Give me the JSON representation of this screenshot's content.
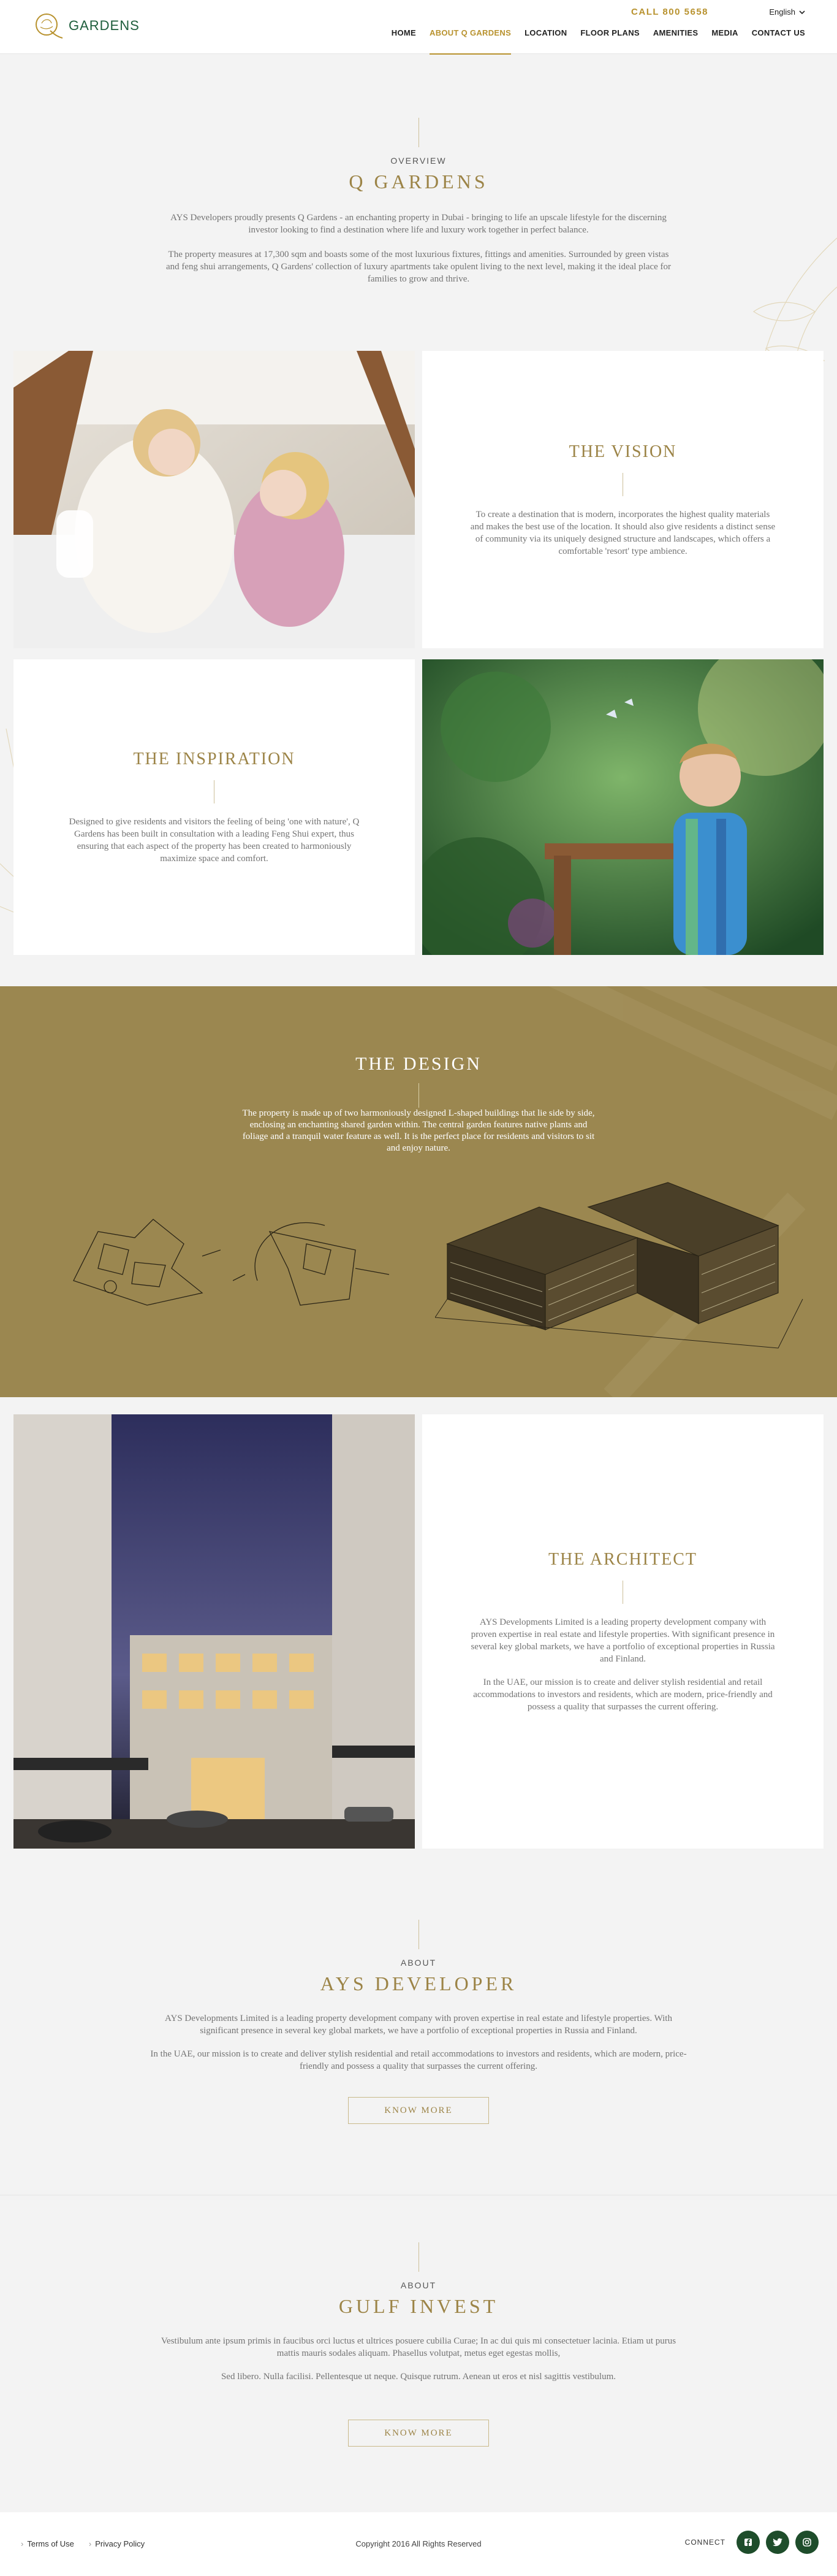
{
  "header": {
    "logo_text": "GARDENS",
    "call": "CALL 800 5658",
    "language": "English",
    "nav": [
      "HOME",
      "ABOUT Q GARDENS",
      "LOCATION",
      "FLOOR PLANS",
      "AMENITIES",
      "MEDIA",
      "CONTACT US"
    ],
    "active_nav": "ABOUT Q GARDENS"
  },
  "overview": {
    "eyebrow": "OVERVIEW",
    "title": "Q GARDENS",
    "p1": "AYS Developers proudly presents Q Gardens - an enchanting property in Dubai - bringing to life an upscale lifestyle for the discerning investor looking to find a destination where life and luxury work together in perfect balance.",
    "p2": "The property measures at 17,300 sqm and boasts some of the most luxurious fixtures, fittings and amenities. Surrounded by green vistas and feng shui arrangements, Q Gardens' collection of luxury apartments take opulent living to the next level, making it the ideal place for families to grow and thrive."
  },
  "vision": {
    "title": "THE VISION",
    "text": "To create a destination that is modern, incorporates the highest quality materials and makes the best use of the location. It should also give residents a distinct sense of community via its uniquely designed structure and landscapes, which offers a comfortable 'resort' type ambience."
  },
  "inspiration": {
    "title": "THE INSPIRATION",
    "text": "Designed to give residents and visitors the feeling of being 'one with nature', Q Gardens has been built in consultation with a leading Feng Shui expert, thus ensuring that each aspect of the property has been created to harmoniously maximize space and comfort."
  },
  "design": {
    "title": "THE DESIGN",
    "text": "The property is made up of two harmoniously designed L-shaped buildings that lie side by side, enclosing an enchanting shared garden within. The central garden features native plants and foliage and a tranquil water feature as well. It is the perfect place for residents and visitors to sit and enjoy nature."
  },
  "architect": {
    "title": "THE ARCHITECT",
    "p1": "AYS Developments Limited is a leading property development company with proven expertise in real estate and lifestyle properties. With significant presence in several key global markets, we have a portfolio of exceptional properties in Russia and Finland.",
    "p2": "In the UAE, our mission is to create and deliver stylish residential and retail accommodations to investors and residents, which are modern, price-friendly and possess a quality that surpasses the current offering."
  },
  "ays": {
    "eyebrow": "ABOUT",
    "title": "AYS DEVELOPER",
    "p1": "AYS Developments Limited is a leading property development company with proven expertise in real estate and lifestyle properties. With significant presence in several key global markets, we have a portfolio of exceptional properties in Russia and Finland.",
    "p2": "In the UAE, our mission is to create and deliver stylish residential and retail accommodations to investors and residents, which are modern, price-friendly and possess a quality that surpasses the current offering.",
    "button": "KNOW MORE"
  },
  "gulf": {
    "eyebrow": "ABOUT",
    "title": "GULF INVEST",
    "p1": "Vestibulum ante ipsum primis in faucibus orci luctus et ultrices posuere cubilia Curae; In ac dui quis mi consectetuer lacinia. Etiam ut purus mattis mauris sodales aliquam. Phasellus volutpat, metus eget egestas mollis,",
    "p2": "Sed libero. Nulla facilisi. Pellentesque ut neque. Quisque rutrum. Aenean ut eros et nisl sagittis vestibulum.",
    "button": "KNOW MORE"
  },
  "footer": {
    "terms": "Terms of Use",
    "privacy": "Privacy Policy",
    "copyright": "Copyright 2016 All Rights Reserved",
    "connect": "CONNECT",
    "social_icons": [
      "facebook-icon",
      "twitter-icon",
      "instagram-icon"
    ]
  },
  "colors": {
    "gold": "#9c8447",
    "call_gold": "#b8922e",
    "design_band": "#9b8750",
    "social_green": "#1e4d2b",
    "logo_green": "#1e5e3c"
  }
}
